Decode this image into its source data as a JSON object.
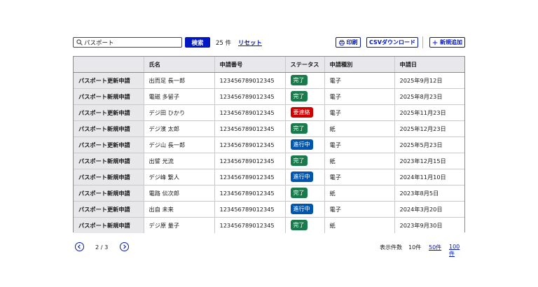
{
  "toolbar": {
    "search_value": "パスポート",
    "search_button": "検索",
    "result_count": "25 件",
    "reset_label": "リセット",
    "print_label": "印刷",
    "csv_label": "CSVダウンロード",
    "add_label": "新規追加"
  },
  "table": {
    "columns": [
      "",
      "氏名",
      "申請番号",
      "ステータス",
      "申請種別",
      "申請日"
    ],
    "rows": [
      {
        "type": "パスポート更新申請",
        "name": "出而足 長一郎",
        "number": "123456789012345",
        "status": "完了",
        "status_color": "#197a4b",
        "method": "電子",
        "date": "2025年9月12日"
      },
      {
        "type": "パスポート新規申請",
        "name": "電磁 多留子",
        "number": "123456789012345",
        "status": "完了",
        "status_color": "#197a4b",
        "method": "電子",
        "date": "2025年8月23日"
      },
      {
        "type": "パスポート更新申請",
        "name": "デジ田 ひかり",
        "number": "123456789012345",
        "status": "要連絡",
        "status_color": "#ce0000",
        "method": "電子",
        "date": "2025年11月23日"
      },
      {
        "type": "パスポート新規申請",
        "name": "デジ濱 太郎",
        "number": "123456789012345",
        "status": "完了",
        "status_color": "#197a4b",
        "method": "紙",
        "date": "2025年12月23日"
      },
      {
        "type": "パスポート更新申請",
        "name": "デジ山 長一郎",
        "number": "123456789012345",
        "status": "進行中",
        "status_color": "#0055ad",
        "method": "電子",
        "date": "2025年5月23日"
      },
      {
        "type": "パスポート新規申請",
        "name": "出譬 光流",
        "number": "123456789012345",
        "status": "完了",
        "status_color": "#197a4b",
        "method": "紙",
        "date": "2023年12月15日"
      },
      {
        "type": "パスポート新規申請",
        "name": "デジ峰 繋人",
        "number": "123456789012345",
        "status": "進行中",
        "status_color": "#0055ad",
        "method": "電子",
        "date": "2024年11月10日"
      },
      {
        "type": "パスポート新規申請",
        "name": "電路 伝次郎",
        "number": "123456789012345",
        "status": "完了",
        "status_color": "#197a4b",
        "method": "紙",
        "date": "2023年8月5日"
      },
      {
        "type": "パスポート更新申請",
        "name": "出自 未来",
        "number": "123456789012345",
        "status": "進行中",
        "status_color": "#0055ad",
        "method": "電子",
        "date": "2024年3月20日"
      },
      {
        "type": "パスポート新規申請",
        "name": "デジ原 量子",
        "number": "123456789012345",
        "status": "完了",
        "status_color": "#197a4b",
        "method": "紙",
        "date": "2023年9月30日"
      }
    ]
  },
  "pager": {
    "page_label": "2 / 3",
    "per_page_label": "表示件数",
    "per_page_options": [
      "10件",
      "50件",
      "100件"
    ]
  },
  "colors": {
    "accent": "#0017c1",
    "status_complete": "#197a4b",
    "status_contact": "#ce0000",
    "status_progress": "#0055ad"
  }
}
